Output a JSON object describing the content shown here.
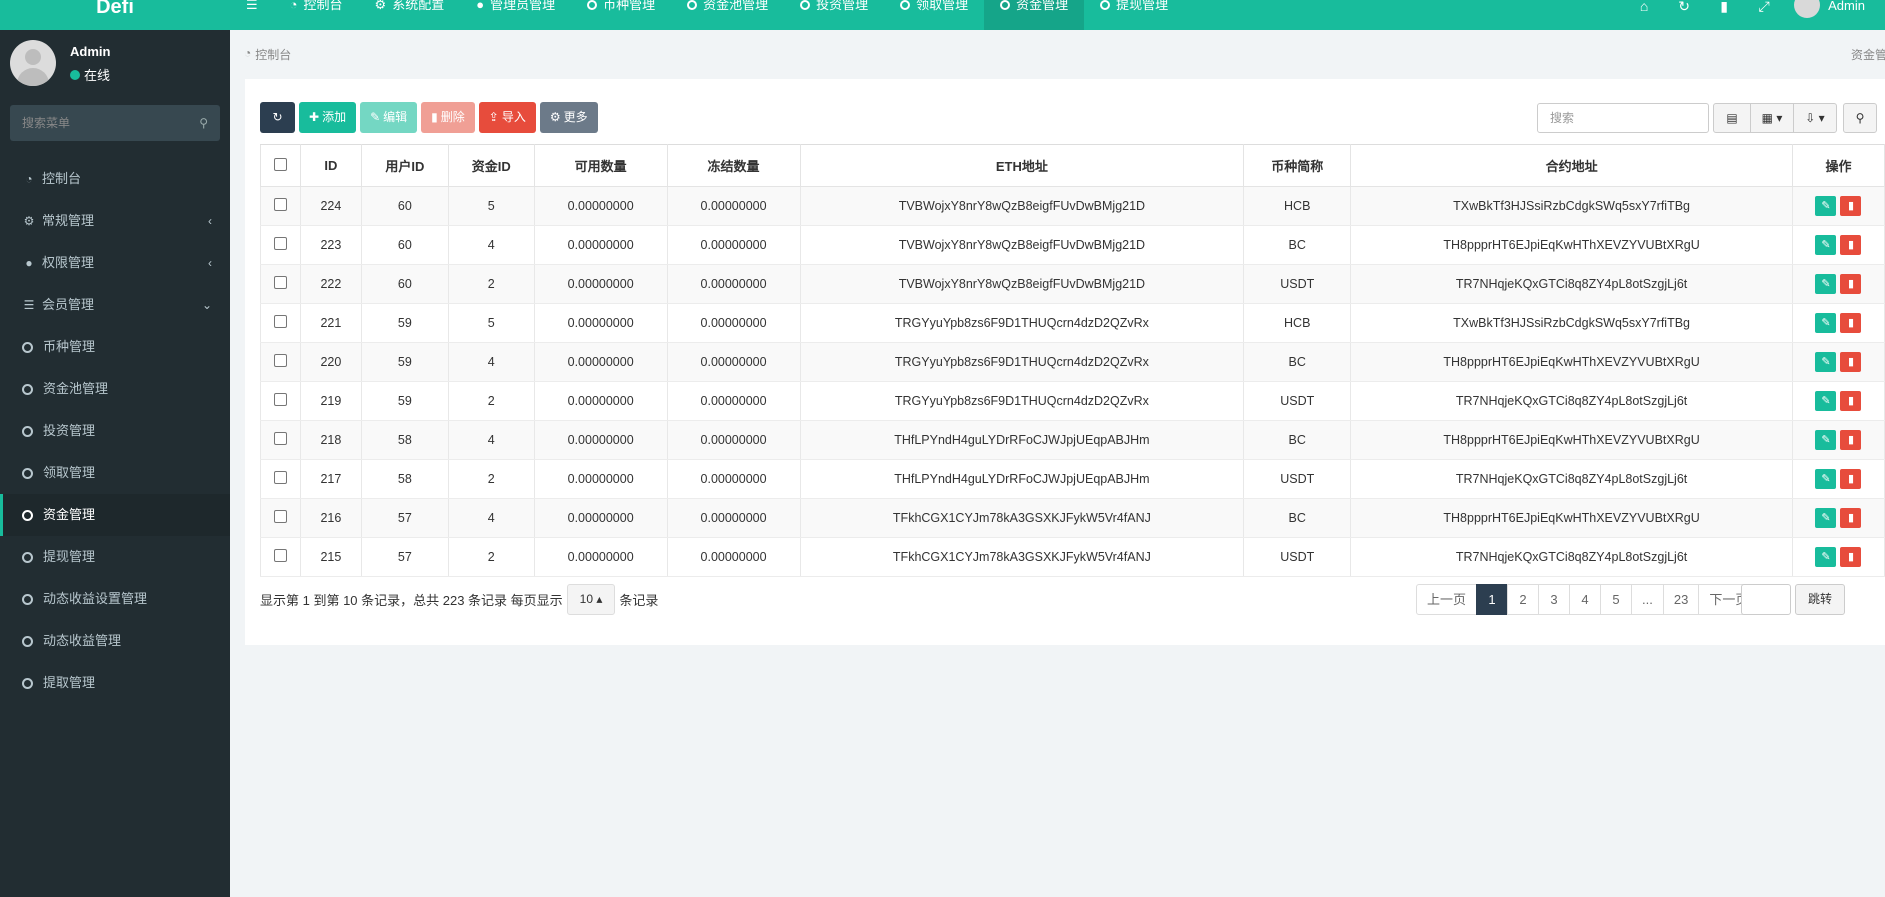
{
  "app": {
    "logo": "Defi"
  },
  "topnav": [
    {
      "icon": "hamburger-icon",
      "label": ""
    },
    {
      "icon": "dashboard-icon",
      "label": "控制台"
    },
    {
      "icon": "gear-icon",
      "label": "系统配置"
    },
    {
      "icon": "user-icon",
      "label": "管理员管理"
    },
    {
      "icon": "circle-icon",
      "label": "币种管理"
    },
    {
      "icon": "circle-icon",
      "label": "资金池管理"
    },
    {
      "icon": "circle-icon",
      "label": "投资管理"
    },
    {
      "icon": "circle-icon",
      "label": "领取管理"
    },
    {
      "icon": "circle-icon",
      "label": "资金管理",
      "active": true
    },
    {
      "icon": "circle-icon",
      "label": "提现管理"
    }
  ],
  "topright": {
    "icons": [
      "home-icon",
      "refresh-icon",
      "trash-icon",
      "fullscreen-icon"
    ],
    "user": "Admin"
  },
  "sidebar": {
    "user_name": "Admin",
    "user_status": "在线",
    "search_placeholder": "搜索菜单",
    "items": [
      {
        "icon": "dashboard-icon",
        "label": "控制台",
        "chevron": ""
      },
      {
        "icon": "cogs-icon",
        "label": "常规管理",
        "chevron": "‹"
      },
      {
        "icon": "group-icon",
        "label": "权限管理",
        "chevron": "‹"
      },
      {
        "icon": "list-icon",
        "label": "会员管理",
        "chevron": "⌄"
      },
      {
        "icon": "circle-icon",
        "label": "币种管理",
        "chevron": ""
      },
      {
        "icon": "circle-icon",
        "label": "资金池管理",
        "chevron": ""
      },
      {
        "icon": "circle-icon",
        "label": "投资管理",
        "chevron": ""
      },
      {
        "icon": "circle-icon",
        "label": "领取管理",
        "chevron": ""
      },
      {
        "icon": "circle-icon",
        "label": "资金管理",
        "chevron": "",
        "active": true
      },
      {
        "icon": "circle-icon",
        "label": "提现管理",
        "chevron": ""
      },
      {
        "icon": "circle-icon",
        "label": "动态收益设置管理",
        "chevron": ""
      },
      {
        "icon": "circle-icon",
        "label": "动态收益管理",
        "chevron": ""
      },
      {
        "icon": "circle-icon",
        "label": "提取管理",
        "chevron": ""
      }
    ]
  },
  "breadcrumb": {
    "home": "控制台",
    "right": "资金管理"
  },
  "toolbar": {
    "refresh_label": "",
    "add_label": "添加",
    "edit_label": "编辑",
    "delete_label": "删除",
    "import_label": "导入",
    "more_label": "更多",
    "search_placeholder": "搜索"
  },
  "table": {
    "columns": [
      "ID",
      "用户ID",
      "资金ID",
      "可用数量",
      "冻结数量",
      "ETH地址",
      "币种简称",
      "合约地址",
      "操作"
    ],
    "rows": [
      [
        "224",
        "60",
        "5",
        "0.00000000",
        "0.00000000",
        "TVBWojxY8nrY8wQzB8eigfFUvDwBMjg21D",
        "HCB",
        "TXwBkTf3HJSsiRzbCdgkSWq5sxY7rfiTBg"
      ],
      [
        "223",
        "60",
        "4",
        "0.00000000",
        "0.00000000",
        "TVBWojxY8nrY8wQzB8eigfFUvDwBMjg21D",
        "BC",
        "TH8ppprHT6EJpiEqKwHThXEVZYVUBtXRgU"
      ],
      [
        "222",
        "60",
        "2",
        "0.00000000",
        "0.00000000",
        "TVBWojxY8nrY8wQzB8eigfFUvDwBMjg21D",
        "USDT",
        "TR7NHqjeKQxGTCi8q8ZY4pL8otSzgjLj6t"
      ],
      [
        "221",
        "59",
        "5",
        "0.00000000",
        "0.00000000",
        "TRGYyuYpb8zs6F9D1THUQcrn4dzD2QZvRx",
        "HCB",
        "TXwBkTf3HJSsiRzbCdgkSWq5sxY7rfiTBg"
      ],
      [
        "220",
        "59",
        "4",
        "0.00000000",
        "0.00000000",
        "TRGYyuYpb8zs6F9D1THUQcrn4dzD2QZvRx",
        "BC",
        "TH8ppprHT6EJpiEqKwHThXEVZYVUBtXRgU"
      ],
      [
        "219",
        "59",
        "2",
        "0.00000000",
        "0.00000000",
        "TRGYyuYpb8zs6F9D1THUQcrn4dzD2QZvRx",
        "USDT",
        "TR7NHqjeKQxGTCi8q8ZY4pL8otSzgjLj6t"
      ],
      [
        "218",
        "58",
        "4",
        "0.00000000",
        "0.00000000",
        "THfLPYndH4guLYDrRFoCJWJpjUEqpABJHm",
        "BC",
        "TH8ppprHT6EJpiEqKwHThXEVZYVUBtXRgU"
      ],
      [
        "217",
        "58",
        "2",
        "0.00000000",
        "0.00000000",
        "THfLPYndH4guLYDrRFoCJWJpjUEqpABJHm",
        "USDT",
        "TR7NHqjeKQxGTCi8q8ZY4pL8otSzgjLj6t"
      ],
      [
        "216",
        "57",
        "4",
        "0.00000000",
        "0.00000000",
        "TFkhCGX1CYJm78kA3GSXKJFykW5Vr4fANJ",
        "BC",
        "TH8ppprHT6EJpiEqKwHThXEVZYVUBtXRgU"
      ],
      [
        "215",
        "57",
        "2",
        "0.00000000",
        "0.00000000",
        "TFkhCGX1CYJm78kA3GSXKJFykW5Vr4fANJ",
        "USDT",
        "TR7NHqjeKQxGTCi8q8ZY4pL8otSzgjLj6t"
      ]
    ]
  },
  "footer": {
    "info_prefix": "显示第 1 到第 10 条记录，总共 223 条记录 每页显示",
    "page_size": "10",
    "info_suffix": "条记录",
    "pages": [
      "上一页",
      "1",
      "2",
      "3",
      "4",
      "5",
      "...",
      "23",
      "下一页"
    ],
    "active_page": "1",
    "jump_label": "跳转"
  },
  "colors": {
    "accent": "#18bc9c",
    "sidebar": "#222d32",
    "danger": "#e74c3c",
    "dark": "#2c3e50"
  }
}
